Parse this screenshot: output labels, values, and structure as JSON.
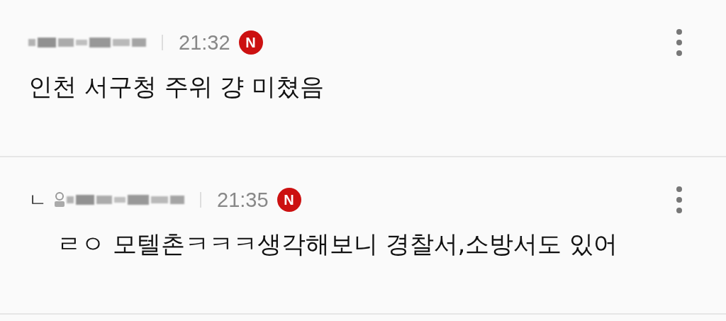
{
  "comments": [
    {
      "kind": "comment",
      "time": "21:32",
      "badge": "N",
      "text": "인천 서구청 주위 걍 미쳤음"
    },
    {
      "kind": "reply",
      "reply_mark": "ㄴ",
      "time": "21:35",
      "badge": "N",
      "text": "ㄹㅇ 모텔촌ㅋㅋㅋ생각해보니 경찰서,소방서도 있어"
    }
  ]
}
